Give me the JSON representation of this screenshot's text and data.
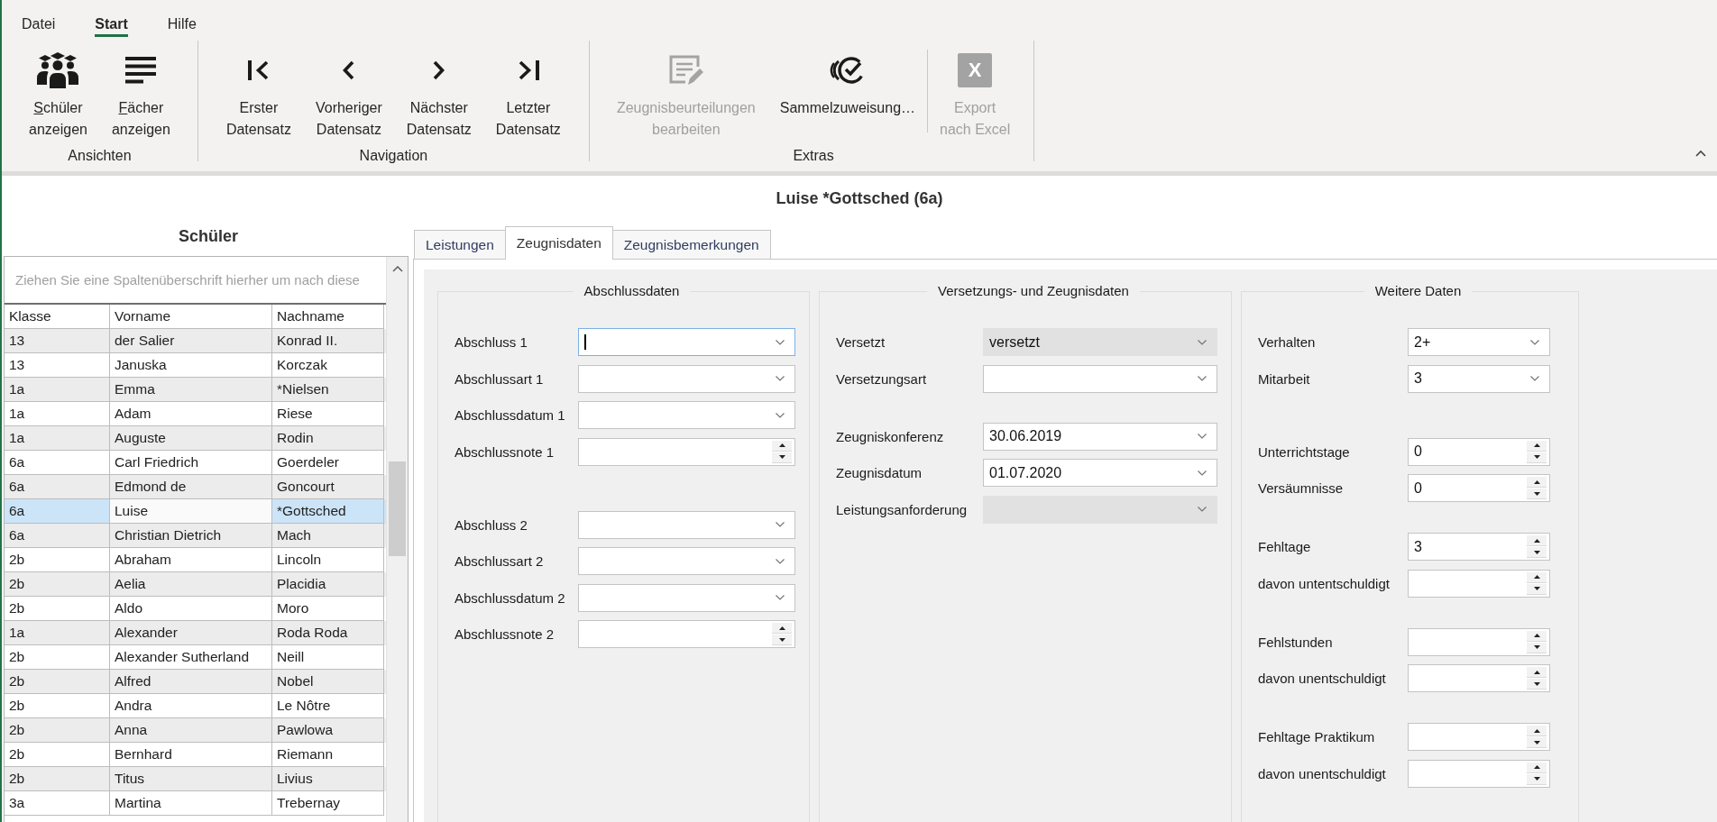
{
  "menu": [
    {
      "label": "Datei",
      "selected": false
    },
    {
      "label": "Start",
      "selected": true
    },
    {
      "label": "Hilfe",
      "selected": false
    }
  ],
  "ribbon": {
    "groups": [
      {
        "label": "Ansichten",
        "clusters": [
          [
            {
              "lines": [
                "Schüler",
                "anzeigen"
              ],
              "mnemonic": true,
              "disabled": false
            },
            {
              "lines": [
                "Fächer",
                "anzeigen"
              ],
              "mnemonic": true,
              "disabled": false
            }
          ]
        ]
      },
      {
        "label": "Navigation",
        "clusters": [
          [
            {
              "lines": [
                "Erster",
                "Datensatz"
              ],
              "mnemonic": false,
              "disabled": false
            },
            {
              "lines": [
                "Vorheriger",
                "Datensatz"
              ],
              "mnemonic": false,
              "disabled": false
            },
            {
              "lines": [
                "Nächster",
                "Datensatz"
              ],
              "mnemonic": false,
              "disabled": false
            },
            {
              "lines": [
                "Letzter",
                "Datensatz"
              ],
              "mnemonic": false,
              "disabled": false
            }
          ]
        ]
      },
      {
        "label": "Extras",
        "clusters": [
          [
            {
              "lines": [
                "Zeugnisbeurteilungen",
                "bearbeiten"
              ],
              "mnemonic": false,
              "disabled": true
            },
            {
              "lines": [
                "Sammelzuweisung…"
              ],
              "mnemonic": false,
              "disabled": false
            }
          ],
          [
            {
              "lines": [
                "Export",
                "nach Excel"
              ],
              "icon_letter": "X",
              "mnemonic": false,
              "disabled": true
            }
          ]
        ]
      }
    ]
  },
  "record_title": "Luise *Gottsched (6a)",
  "students_panel": {
    "title": "Schüler",
    "group_hint": "Ziehen Sie eine Spaltenüberschrift hierher um nach diese",
    "columns": [
      {
        "label": "Klasse",
        "focused": false
      },
      {
        "label": "Vorname",
        "focused": true
      },
      {
        "label": "Nachname",
        "focused": false
      }
    ],
    "rows": [
      {
        "cells": [
          "13",
          "der Salier",
          "Konrad II."
        ],
        "selected": false
      },
      {
        "cells": [
          "13",
          "Januska",
          "Korczak"
        ],
        "selected": false
      },
      {
        "cells": [
          "1a",
          "Emma",
          "*Nielsen"
        ],
        "selected": false
      },
      {
        "cells": [
          "1a",
          "Adam",
          "Riese"
        ],
        "selected": false
      },
      {
        "cells": [
          "1a",
          "Auguste",
          "Rodin"
        ],
        "selected": false
      },
      {
        "cells": [
          "6a",
          "Carl Friedrich",
          "Goerdeler"
        ],
        "selected": false
      },
      {
        "cells": [
          "6a",
          "Edmond de",
          "Goncourt"
        ],
        "selected": false
      },
      {
        "cells": [
          "6a",
          "Luise",
          "*Gottsched"
        ],
        "selected": true
      },
      {
        "cells": [
          "6a",
          "Christian Dietrich",
          "Mach"
        ],
        "selected": false
      },
      {
        "cells": [
          "2b",
          "Abraham",
          "Lincoln"
        ],
        "selected": false
      },
      {
        "cells": [
          "2b",
          "Aelia",
          "Placidia"
        ],
        "selected": false
      },
      {
        "cells": [
          "2b",
          "Aldo",
          "Moro"
        ],
        "selected": false
      },
      {
        "cells": [
          "1a",
          "Alexander",
          "Roda Roda"
        ],
        "selected": false
      },
      {
        "cells": [
          "2b",
          "Alexander Sutherland",
          "Neill"
        ],
        "selected": false
      },
      {
        "cells": [
          "2b",
          "Alfred",
          "Nobel"
        ],
        "selected": false
      },
      {
        "cells": [
          "2b",
          "Andra",
          "Le Nôtre"
        ],
        "selected": false
      },
      {
        "cells": [
          "2b",
          "Anna",
          "Pawlowa"
        ],
        "selected": false
      },
      {
        "cells": [
          "2b",
          "Bernhard",
          "Riemann"
        ],
        "selected": false
      },
      {
        "cells": [
          "2b",
          "Titus",
          "Livius"
        ],
        "selected": false
      },
      {
        "cells": [
          "3a",
          "Martina",
          "Trebernay"
        ],
        "selected": false
      }
    ]
  },
  "form": {
    "tabs": [
      {
        "label": "Leistungen",
        "selected": false
      },
      {
        "label": "Zeugnisdaten",
        "selected": true
      },
      {
        "label": "Zeugnisbemerkungen",
        "selected": false
      }
    ],
    "groups": [
      {
        "title": "Abschlussdaten",
        "sections": [
          [
            {
              "label": "Abschluss 1",
              "kind": "combo",
              "disabled": false,
              "focused": true
            },
            {
              "label": "Abschlussart 1",
              "kind": "combo",
              "disabled": false,
              "focused": false
            },
            {
              "label": "Abschlussdatum 1",
              "kind": "combo",
              "disabled": false,
              "focused": false
            },
            {
              "label": "Abschlussnote 1",
              "kind": "spin",
              "disabled": false,
              "focused": false
            }
          ],
          [
            {
              "label": "Abschluss 2",
              "kind": "combo",
              "disabled": false,
              "focused": false
            },
            {
              "label": "Abschlussart 2",
              "kind": "combo",
              "disabled": false,
              "focused": false
            },
            {
              "label": "Abschlussdatum 2",
              "kind": "combo",
              "disabled": false,
              "focused": false
            },
            {
              "label": "Abschlussnote 2",
              "kind": "spin",
              "disabled": false,
              "focused": false
            }
          ]
        ]
      },
      {
        "title": "Versetzungs- und Zeugnisdaten",
        "sections": [
          [
            {
              "label": "Versetzt",
              "kind": "combo",
              "value": "versetzt",
              "disabled": true,
              "focused": false
            },
            {
              "label": "Versetzungsart",
              "kind": "combo",
              "disabled": false,
              "focused": false
            }
          ],
          [
            {
              "label": "Zeugniskonferenz",
              "kind": "combo",
              "value": "30.06.2019",
              "disabled": false,
              "focused": false
            },
            {
              "label": "Zeugnisdatum",
              "kind": "combo",
              "value": "01.07.2020",
              "disabled": false,
              "focused": false
            },
            {
              "label": "Leistungsanforderung",
              "kind": "combo",
              "disabled": true,
              "focused": false
            }
          ]
        ]
      },
      {
        "title": "Weitere Daten",
        "sections": [
          [
            {
              "label": "Verhalten",
              "kind": "combo",
              "value": "2+",
              "disabled": false,
              "focused": false
            },
            {
              "label": "Mitarbeit",
              "kind": "combo",
              "value": "3",
              "disabled": false,
              "focused": false
            }
          ],
          [
            {
              "label": "Unterrichtstage",
              "kind": "spin",
              "value": "0",
              "disabled": false,
              "focused": false
            },
            {
              "label": "Versäumnisse",
              "kind": "spin",
              "value": "0",
              "disabled": false,
              "focused": false
            }
          ],
          [
            {
              "label": "Fehltage",
              "kind": "spin",
              "value": "3",
              "disabled": false,
              "focused": false
            },
            {
              "label": "davon untentschuldigt",
              "kind": "spin",
              "disabled": false,
              "focused": false
            }
          ],
          [
            {
              "label": "Fehlstunden",
              "kind": "spin",
              "disabled": false,
              "focused": false
            },
            {
              "label": "davon unentschuldigt",
              "kind": "spin",
              "disabled": false,
              "focused": false
            }
          ],
          [
            {
              "label": "Fehltage Praktikum",
              "kind": "spin",
              "disabled": false,
              "focused": false
            },
            {
              "label": "davon unentschuldigt",
              "kind": "spin",
              "disabled": false,
              "focused": false
            }
          ]
        ]
      }
    ]
  }
}
